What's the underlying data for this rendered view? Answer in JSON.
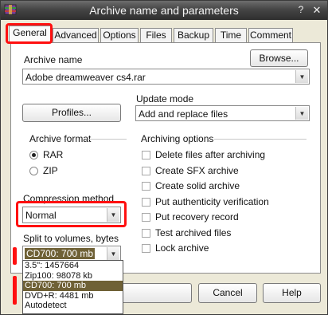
{
  "window": {
    "title": "Archive name and parameters",
    "help_glyph": "?",
    "close_glyph": "✕"
  },
  "tabs": [
    {
      "label": "General",
      "active": true
    },
    {
      "label": "Advanced"
    },
    {
      "label": "Options"
    },
    {
      "label": "Files"
    },
    {
      "label": "Backup"
    },
    {
      "label": "Time"
    },
    {
      "label": "Comment"
    }
  ],
  "general": {
    "archive_name_label": "Archive name",
    "browse_label": "Browse...",
    "archive_name_value": "Adobe dreamweaver cs4.rar",
    "update_mode_label": "Update mode",
    "profiles_label": "Profiles...",
    "update_mode_value": "Add and replace files",
    "archive_format_label": "Archive format",
    "format_rar": "RAR",
    "format_zip": "ZIP",
    "selected_format": "RAR",
    "compression_label": "Compression method",
    "compression_value": "Normal",
    "split_label": "Split to volumes, bytes",
    "split_value": "CD700:  700 mb",
    "archiving_options_label": "Archiving options",
    "options": [
      {
        "label": "Delete files after archiving",
        "checked": false
      },
      {
        "label": "Create SFX archive",
        "checked": false
      },
      {
        "label": "Create solid archive",
        "checked": false
      },
      {
        "label": "Put authenticity verification",
        "checked": false
      },
      {
        "label": "Put recovery record",
        "checked": false
      },
      {
        "label": "Test archived files",
        "checked": false
      },
      {
        "label": "Lock archive",
        "checked": false
      }
    ]
  },
  "split_dropdown": {
    "items": [
      {
        "label": "3.5\":     1457664"
      },
      {
        "label": "Zip100:  98078 kb"
      },
      {
        "label": "CD700:  700 mb",
        "selected": true
      },
      {
        "label": "DVD+R: 4481 mb"
      },
      {
        "label": "Autodetect"
      }
    ]
  },
  "buttons": {
    "cancel": "Cancel",
    "help": "Help"
  },
  "colors": {
    "highlight": "#ff1010",
    "selected_item": "#6f6136",
    "titlebar": "#3a3a3a"
  },
  "icons": {
    "app": "winrar-icon",
    "dropdown_arrow": "chevron-down-icon"
  }
}
